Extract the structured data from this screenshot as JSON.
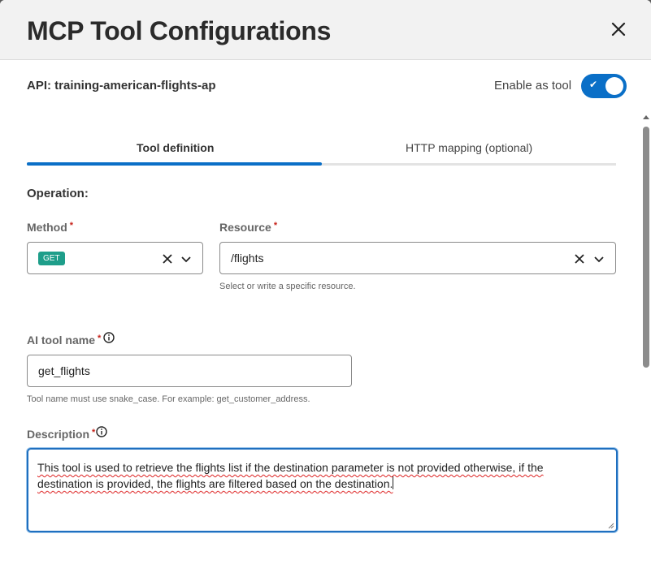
{
  "header": {
    "title": "MCP Tool Configurations"
  },
  "api": {
    "label": "API: training-american-flights-ap"
  },
  "enable_tool": {
    "label": "Enable as tool",
    "enabled": true
  },
  "tabs": [
    {
      "label": "Tool definition",
      "active": true
    },
    {
      "label": "HTTP mapping (optional)",
      "active": false
    }
  ],
  "operation": {
    "title": "Operation:"
  },
  "method": {
    "label": "Method",
    "required": "*",
    "value": "GET",
    "badge_color": "#1e9e8a"
  },
  "resource": {
    "label": "Resource",
    "required": "*",
    "value": "/flights",
    "hint": "Select or write a specific resource."
  },
  "tool_name": {
    "label": "AI tool name",
    "required": "*",
    "value": "get_flights",
    "hint": "Tool name must use snake_case. For example: get_customer_address."
  },
  "description": {
    "label": "Description",
    "required": "*",
    "value": "This tool is used to retrieve the flights list if the destination parameter is not provided otherwise, if the destination is provided, the flights are filtered based on the destination."
  },
  "colors": {
    "accent": "#0a6fc7",
    "required": "#c7221a"
  }
}
